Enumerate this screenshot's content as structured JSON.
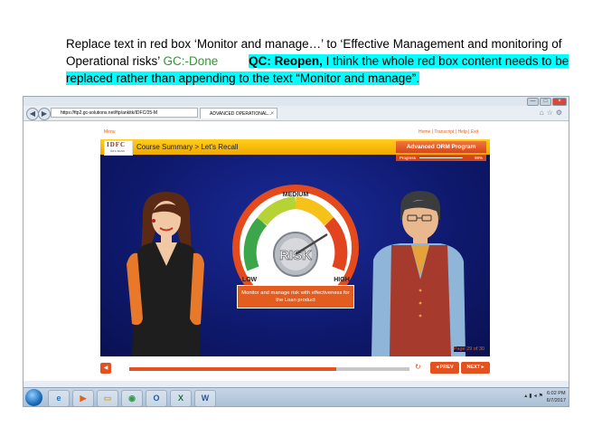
{
  "doc": {
    "line1": "Replace text in red box ‘Monitor and manage…’ to ‘Effective Management and monitoring of",
    "line2_a": "Operational risks’ ",
    "gc_status": "GC:-Done",
    "qc_label": "QC: Reopen,",
    "qc_text": " I think the whole red box content needs to be replaced rather than appending to the text “Monitor and manage”."
  },
  "browser": {
    "address": "https://ftp2.gc-solutions.net/ftp/ankitk/IDFC/25-M",
    "tab_title": "ADVANCED OPERATIONAL...",
    "window_buttons": [
      "—",
      "□",
      "×"
    ]
  },
  "page": {
    "menu_label": "Menu",
    "top_links": [
      "Home",
      "Transcript",
      "Help",
      "Exit"
    ]
  },
  "course": {
    "logo_main": "IDFC",
    "logo_sub": "IDFC BANK",
    "title": "Course Summary > Let's Recall",
    "program": "Advanced ORM Program",
    "progress_label": "Progress",
    "progress_value": "98%",
    "progress_fraction": 0.98,
    "gauge": {
      "medium": "MEDIUM",
      "low": "LOW",
      "high": "HIGH",
      "center": "RISK"
    },
    "caption": "Monitor and manage risk with effectiveness for the Loan product",
    "page_num": "Page 29 of 30"
  },
  "controls": {
    "seek_fraction": 0.74,
    "prev": "◂ PREV",
    "next": "NEXT ▸"
  },
  "taskbar": {
    "apps": [
      {
        "icon": "internet-explorer-icon",
        "glyph": "e",
        "color": "#1e73c8"
      },
      {
        "icon": "media-player-icon",
        "glyph": "▶",
        "color": "#e2611a"
      },
      {
        "icon": "folder-icon",
        "glyph": "▭",
        "color": "#d8a329"
      },
      {
        "icon": "chrome-icon",
        "glyph": "◉",
        "color": "#2f9c46"
      },
      {
        "icon": "outlook-icon",
        "glyph": "O",
        "color": "#1b5aa8"
      },
      {
        "icon": "excel-icon",
        "glyph": "X",
        "color": "#1e7145"
      },
      {
        "icon": "word-icon",
        "glyph": "W",
        "color": "#2b579a"
      }
    ],
    "time": "6:02 PM",
    "date": "6/7/2017"
  }
}
